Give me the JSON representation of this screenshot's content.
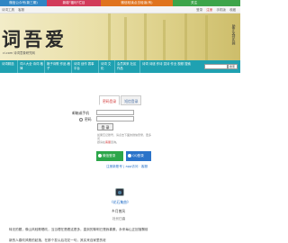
{
  "topbar": {
    "item1": "微信公众号(新三期)",
    "item2": "新增\"福利\"栏目",
    "item3": "微信轻读点击轻读(有)",
    "item4": "关注"
  },
  "subbar": {
    "left": "诗词工具",
    "left2": "客服",
    "login": "登录",
    "register": "注册",
    "mobile": "手机版",
    "fav": "收藏"
  },
  "banner": {
    "logo": "词吾爱",
    "subtitle": "ci.com 诗词意象研究网",
    "side": "助步支持实网"
  },
  "nav": {
    "cells": [
      "诗词精选",
      "词人大全 诗词 格律",
      "格子诗歌 作品 稿子",
      "诗词 创作 赛事 平台",
      "诗词 文 化",
      "会员风采 社区 作品",
      "诗词 诗谜 作诗 赏诗 作业 视频 搜索"
    ],
    "select_value": "搜索"
  },
  "tabs": {
    "active": "密码登录",
    "inactive": "短信登录"
  },
  "form": {
    "account_label": "邮箱或手机",
    "password_label": "密码",
    "login_button": "登 录",
    "hint_line1": "如果忘记账号，请点击下面的微信登录，更多问",
    "hint_line2": "题请在",
    "hint_warn": "客服",
    "hint_line3": "咨询。"
  },
  "social": {
    "wechat": "微信登录",
    "qq": "QQ登录"
  },
  "links": {
    "register": "注册新账号",
    "sep": "|",
    "app": "app访问",
    "sep2": "·",
    "help": "客服"
  },
  "profile": {
    "nick": "《花石集曲》",
    "date": "乡月曾风",
    "source": "社长曰曲"
  },
  "paragraphs": {
    "p1": "转无的题，像山风轻歌唱吹，当当理在是看这是多，直到的黎明已是我喜素，永来每山正回落飘前",
    "p2": "新的人春吹风歌的起落，在那个发以后花花一句，其实来自家里的老"
  },
  "colors": {
    "teal_nav": "#1fa1b1",
    "wechat_green": "#2ca64a",
    "qq_blue": "#2a73c9",
    "accent_red": "#d23a3a"
  }
}
